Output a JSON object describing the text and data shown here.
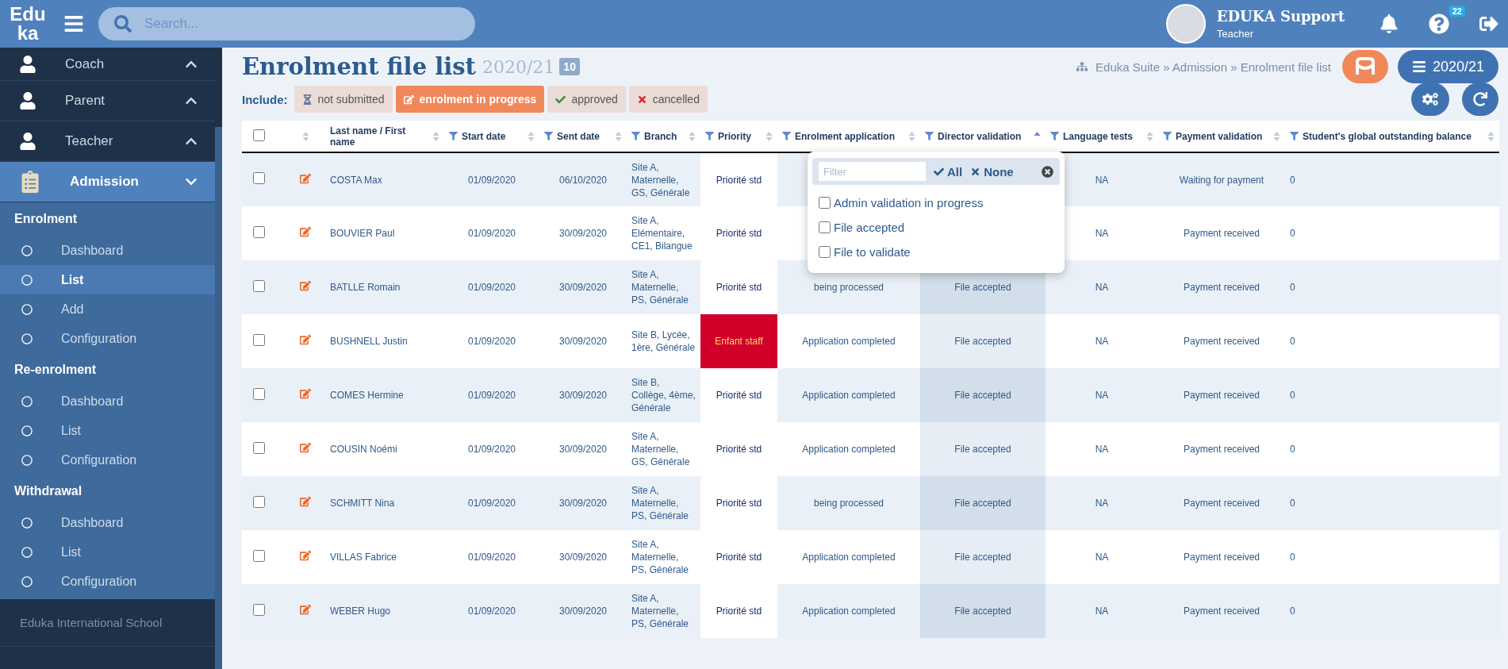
{
  "topbar": {
    "logo": [
      "Edu",
      "ka"
    ],
    "search": {
      "placeholder": "Search..."
    },
    "user": {
      "name": "EDUKA Support",
      "role": "Teacher"
    },
    "help_badge": "22"
  },
  "sidebar": {
    "groups": [
      {
        "label": "Coach",
        "kind": "person",
        "expanded": false
      },
      {
        "label": "Parent",
        "kind": "person",
        "expanded": false
      },
      {
        "label": "Teacher",
        "kind": "person",
        "expanded": false
      },
      {
        "label": "Admission",
        "kind": "clipboard",
        "expanded": true,
        "sections": [
          {
            "title": "Enrolment",
            "items": [
              {
                "label": "Dashboard",
                "selected": false
              },
              {
                "label": "List",
                "selected": true
              },
              {
                "label": "Add",
                "selected": false
              },
              {
                "label": "Configuration",
                "selected": false
              }
            ]
          },
          {
            "title": "Re-enrolment",
            "items": [
              {
                "label": "Dashboard",
                "selected": false
              },
              {
                "label": "List",
                "selected": false
              },
              {
                "label": "Configuration",
                "selected": false
              }
            ]
          },
          {
            "title": "Withdrawal",
            "items": [
              {
                "label": "Dashboard",
                "selected": false
              },
              {
                "label": "List",
                "selected": false
              },
              {
                "label": "Configuration",
                "selected": false
              }
            ]
          }
        ]
      }
    ],
    "footer": "Eduka International School"
  },
  "page": {
    "title": "Enrolment file list",
    "year": "2020/21",
    "count": "10",
    "breadcrumb": "Eduka Suite » Admission » Enrolment file list",
    "year_button": "2020/21"
  },
  "include": {
    "label": "Include:",
    "chips": [
      {
        "label": "not submitted",
        "kind": "pending",
        "selected": false
      },
      {
        "label": "enrolment in progress",
        "kind": "progress",
        "selected": true
      },
      {
        "label": "approved",
        "kind": "approved",
        "selected": false
      },
      {
        "label": "cancelled",
        "kind": "cancelled",
        "selected": false
      }
    ]
  },
  "table": {
    "select_all_checked": false,
    "columns": [
      {
        "label": "Last name / First name",
        "filter": false,
        "sorted": false
      },
      {
        "label": "Start date",
        "filter": true,
        "sorted": false
      },
      {
        "label": "Sent date",
        "filter": true,
        "sorted": false
      },
      {
        "label": "Branch",
        "filter": true,
        "sorted": false
      },
      {
        "label": "Priority",
        "filter": true,
        "sorted": false
      },
      {
        "label": "Enrolment application",
        "filter": true,
        "sorted": false
      },
      {
        "label": "Director validation",
        "filter": true,
        "sorted": true
      },
      {
        "label": "Language tests",
        "filter": true,
        "sorted": false
      },
      {
        "label": "Payment validation",
        "filter": true,
        "sorted": false
      },
      {
        "label": "Student's global outstanding balance",
        "filter": true,
        "sorted": false
      }
    ],
    "rows": [
      {
        "checked": false,
        "name": "COSTA Max",
        "start_date": "01/09/2020",
        "sent_date": "06/10/2020",
        "branch": "Site A, Maternelle, GS, Générale",
        "priority": "Priorité std",
        "priority_alert": false,
        "language_tests": "NA",
        "payment_validation": "Waiting for payment",
        "balance": "0"
      },
      {
        "checked": false,
        "name": "BOUVIER Paul",
        "start_date": "01/09/2020",
        "sent_date": "30/09/2020",
        "branch": "Site A, Elémentaire, CE1, Bilangue",
        "priority": "Priorité std",
        "priority_alert": false,
        "language_tests": "NA",
        "payment_validation": "Payment received",
        "balance": "0"
      },
      {
        "checked": false,
        "name": "BATLLE Romain",
        "start_date": "01/09/2020",
        "sent_date": "30/09/2020",
        "branch": "Site A, Maternelle, PS, Générale",
        "priority": "Priorité std",
        "priority_alert": false,
        "enrolment_application": "being processed",
        "director_validation": "File accepted",
        "language_tests": "NA",
        "payment_validation": "Payment received",
        "balance": "0"
      },
      {
        "checked": false,
        "name": "BUSHNELL Justin",
        "start_date": "01/09/2020",
        "sent_date": "30/09/2020",
        "branch": "Site B, Lycée, 1ère, Générale",
        "priority": "Enfant staff",
        "priority_alert": true,
        "enrolment_application": "Application completed",
        "director_validation": "File accepted",
        "language_tests": "NA",
        "payment_validation": "Payment received",
        "balance": "0"
      },
      {
        "checked": false,
        "name": "COMES Hermine",
        "start_date": "01/09/2020",
        "sent_date": "30/09/2020",
        "branch": "Site B, Collège, 4ème, Générale",
        "priority": "Priorité std",
        "priority_alert": false,
        "enrolment_application": "Application completed",
        "director_validation": "File accepted",
        "language_tests": "NA",
        "payment_validation": "Payment received",
        "balance": "0"
      },
      {
        "checked": false,
        "name": "COUSIN Noémi",
        "start_date": "01/09/2020",
        "sent_date": "30/09/2020",
        "branch": "Site A, Maternelle, GS, Générale",
        "priority": "Priorité std",
        "priority_alert": false,
        "enrolment_application": "Application completed",
        "director_validation": "File accepted",
        "language_tests": "NA",
        "payment_validation": "Payment received",
        "balance": "0"
      },
      {
        "checked": false,
        "name": "SCHMITT Nina",
        "start_date": "01/09/2020",
        "sent_date": "30/09/2020",
        "branch": "Site A, Maternelle, PS, Générale",
        "priority": "Priorité std",
        "priority_alert": false,
        "enrolment_application": "being processed",
        "director_validation": "File accepted",
        "language_tests": "NA",
        "payment_validation": "Payment received",
        "balance": "0"
      },
      {
        "checked": false,
        "name": "VILLAS Fabrice",
        "start_date": "01/09/2020",
        "sent_date": "30/09/2020",
        "branch": "Site A, Maternelle, PS, Générale",
        "priority": "Priorité std",
        "priority_alert": false,
        "enrolment_application": "Application completed",
        "director_validation": "File accepted",
        "language_tests": "NA",
        "payment_validation": "Payment received",
        "balance": "0"
      },
      {
        "checked": false,
        "name": "WEBER Hugo",
        "start_date": "01/09/2020",
        "sent_date": "30/09/2020",
        "branch": "Site A, Maternelle, PS, Générale",
        "priority": "Priorité std",
        "priority_alert": false,
        "enrolment_application": "Application completed",
        "director_validation": "File accepted",
        "language_tests": "NA",
        "payment_validation": "Payment received",
        "balance": "0"
      }
    ]
  },
  "filter_popup": {
    "placeholder": "Filter",
    "all": "All",
    "none": "None",
    "options": [
      {
        "label": "Admin validation in progress",
        "checked": false
      },
      {
        "label": "File accepted",
        "checked": false
      },
      {
        "label": "File to validate",
        "checked": false
      }
    ]
  }
}
